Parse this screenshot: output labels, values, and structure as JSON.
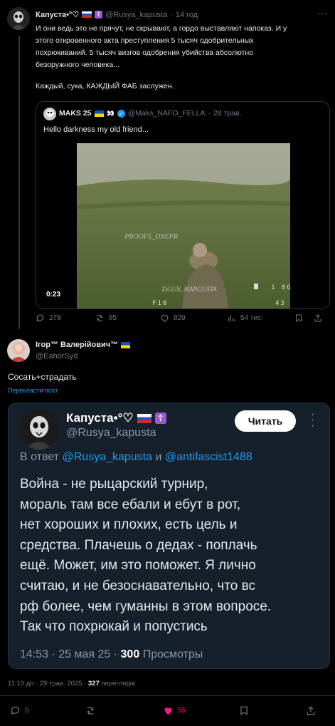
{
  "tweet1": {
    "author_name": "Капуста•°♡",
    "author_handle": "@Rusya_kapusta",
    "time": "14 год",
    "text_lines": [
      "И они ведь это не прячут, не скрывают, а гордо выставляют напоказ. И у",
      "этого откровенного акта преступления 5 тысяч одобрительных",
      "похрюкиваний. 5 тысяч визгов одобрения убийства абсолютно",
      "безоружного человека..."
    ],
    "text_line2": "Каждый, сука, КАЖДЫЙ ФАБ заслужен.",
    "quote": {
      "author_name": "MAKS 25",
      "author_handle": "@Maks_NAFO_FELLA",
      "time": "28 трав.",
      "text": "Hello darkness my old friend...",
      "video_duration": "0:23",
      "watermark1": "PROOFS_DNEPR",
      "watermark2": "ZIGUN_MANGUSTA",
      "hud_top": "1 0G",
      "hud_bottom_left": "F10",
      "hud_bottom_right": "43"
    },
    "actions": {
      "replies": "278",
      "reposts": "85",
      "likes": "829",
      "views": "54 тис."
    }
  },
  "tweet2": {
    "author_name": "Ігор™ Валерійович™",
    "author_handle": "@EahorSyd",
    "text": "Сосать+страдать",
    "translate_label": "Перекласти пост",
    "embedded": {
      "author_name": "Капуста•°♡",
      "author_handle": "@Rusya_kapusta",
      "follow_label": "Читать",
      "reply_prefix": "В ответ",
      "reply_user1": "@Rusya_kapusta",
      "reply_and": "и",
      "reply_user2": "@antifascist1488",
      "text_lines": [
        "Война - не рыцарский турнир,",
        "мораль там все ебали и ебут в рот,",
        "нет хороших и плохих, есть цель и",
        "средства. Плачешь о дедах - поплачь",
        "ещё. Может, им это поможет. Я лично",
        "считаю, и не безоснавательно, что вс",
        "рф более, чем гуманны в этом вопросе.",
        "Так что похрюкай и попустись"
      ],
      "footer_time": "14:53 · 25 мая 25 ·",
      "footer_views_count": "300",
      "footer_views_label": "Просмотры"
    },
    "meta_time": "11:10 дп · 29 трав. 2025 ·",
    "meta_views_count": "327",
    "meta_views_label": "переглядів",
    "actions": {
      "replies": "5",
      "likes": "55"
    }
  },
  "colors": {
    "background": "#000000",
    "muted": "#71767b",
    "accent_blue": "#1d9bf0",
    "like_pink": "#f91880",
    "card_bg": "#15202b"
  }
}
